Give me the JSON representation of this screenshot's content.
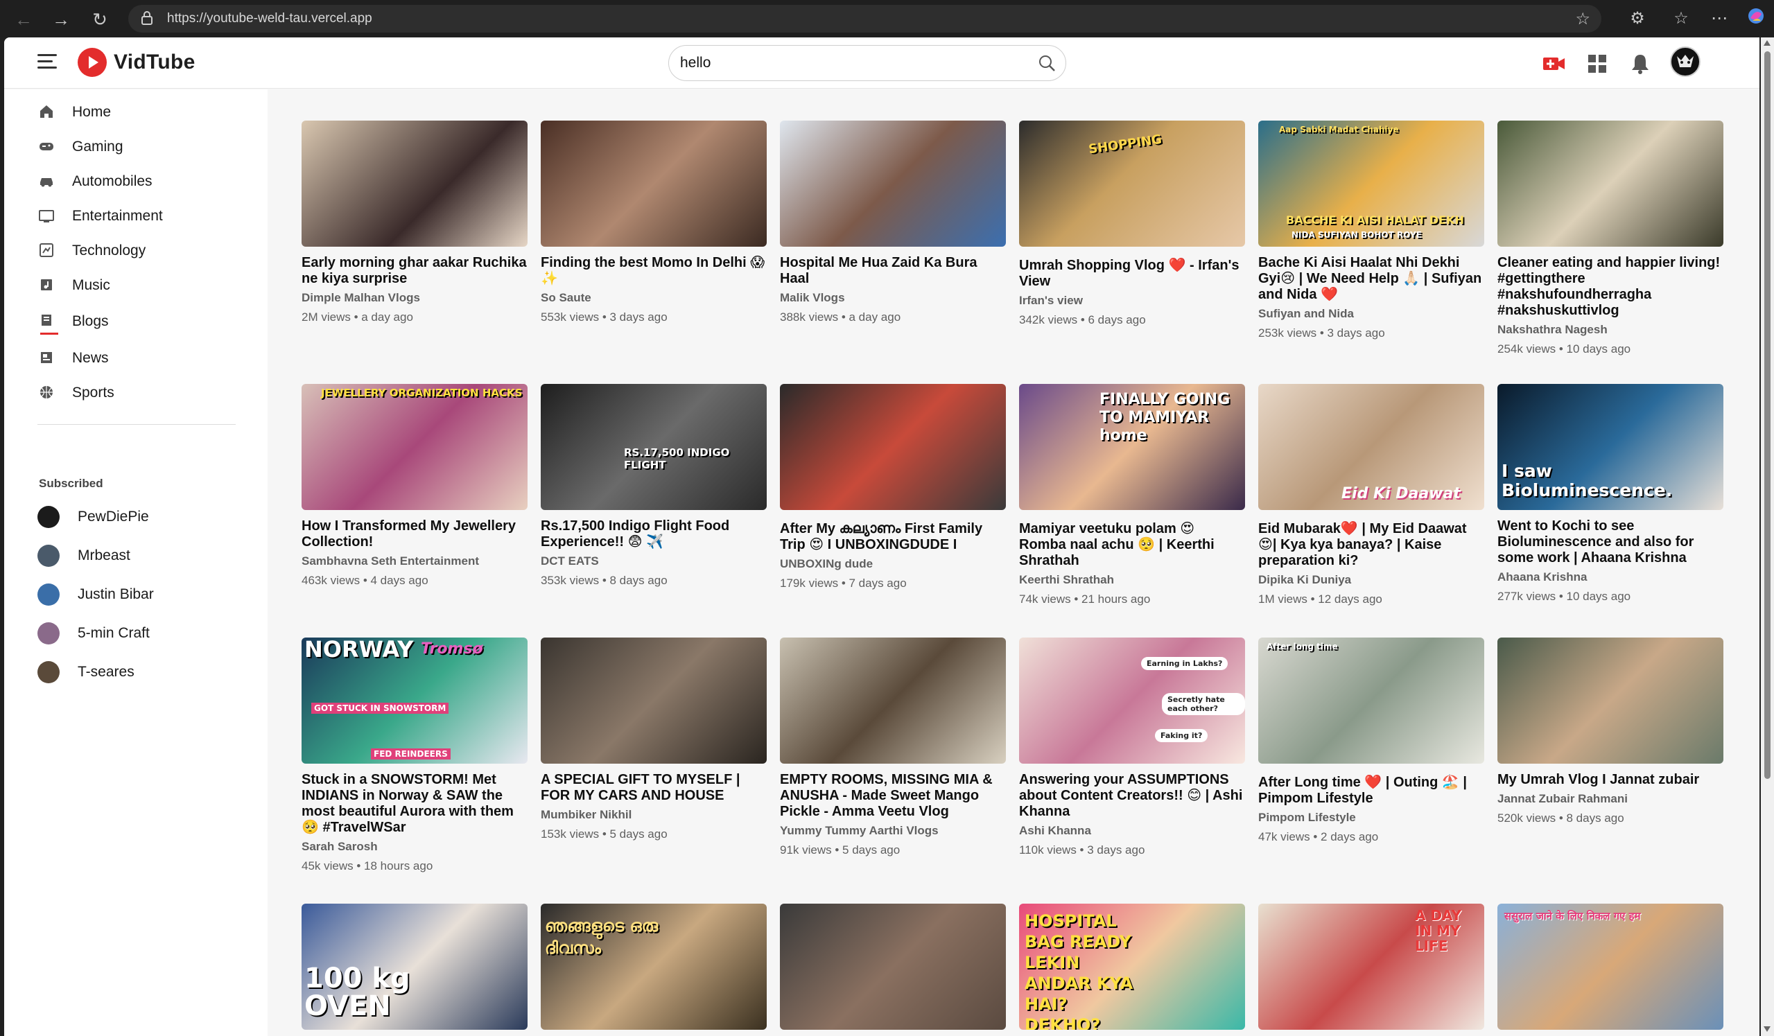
{
  "browser": {
    "url": "https://youtube-weld-tau.vercel.app"
  },
  "header": {
    "logo_text": "VidTube",
    "search_value": "hello"
  },
  "sidebar": {
    "items": [
      {
        "label": "Home",
        "icon": "home-icon"
      },
      {
        "label": "Gaming",
        "icon": "gamepad-icon"
      },
      {
        "label": "Automobiles",
        "icon": "car-icon"
      },
      {
        "label": "Entertainment",
        "icon": "tv-icon"
      },
      {
        "label": "Technology",
        "icon": "technology-icon"
      },
      {
        "label": "Music",
        "icon": "music-icon"
      },
      {
        "label": "Blogs",
        "icon": "blog-icon"
      },
      {
        "label": "News",
        "icon": "news-icon"
      },
      {
        "label": "Sports",
        "icon": "sports-icon"
      }
    ],
    "subscribed_heading": "Subscribed",
    "subscriptions": [
      {
        "name": "PewDiePie",
        "color": "#1b1b1b"
      },
      {
        "name": "Mrbeast",
        "color": "#4a5a6a"
      },
      {
        "name": "Justin Bibar",
        "color": "#3a6ea8"
      },
      {
        "name": "5-min Craft",
        "color": "#8a6a8a"
      },
      {
        "name": "T-seares",
        "color": "#5a4a3a"
      }
    ],
    "active_color": "#e32c2c"
  },
  "videos": [
    {
      "title": "Early morning ghar aakar Ruchika ne kiya surprise",
      "channel": "Dimple Malhan Vlogs",
      "meta": "2M views • a day ago",
      "thumb_bg": "linear-gradient(135deg,#d9c7b0,#3a2a2a 60%,#e6d6c6)"
    },
    {
      "title": "Finding the best Momo In Delhi 😱✨",
      "channel": "So Saute",
      "meta": "553k views • 3 days ago",
      "thumb_bg": "linear-gradient(135deg,#4a2f25,#b08870 50%,#3b2a22)"
    },
    {
      "title": "Hospital Me Hua Zaid Ka Bura Haal",
      "channel": "Malik Vlogs",
      "meta": "388k views • a day ago",
      "thumb_bg": "linear-gradient(135deg,#dfe6ee,#7d5a4a 50%,#3b6fb0)"
    },
    {
      "title": "Umrah Shopping Vlog ❤️ - Irfan's View",
      "channel": "Irfan's view",
      "meta": "342k views • 6 days ago",
      "thumb_bg": "linear-gradient(135deg,#2c2c2c,#c8a060 45%,#e6c8a8)"
    },
    {
      "title": "Bache Ki Aisi Haalat Nhi Dekhi Gyi😢 | We Need Help 🙏🏻 | Sufiyan and Nida ❤️",
      "channel": "Sufiyan and Nida",
      "meta": "253k views • 3 days ago",
      "thumb_bg": "linear-gradient(135deg,#2a6e8a,#e8b04a 50%,#d8d8d8)"
    },
    {
      "title": "Cleaner eating and happier living! #gettingthere #nakshufoundherragha #nakshuskuttivlog",
      "channel": "Nakshathra Nagesh",
      "meta": "254k views • 10 days ago",
      "thumb_bg": "linear-gradient(135deg,#4a5a3a,#dcd0b8 50%,#3a3a2a)"
    },
    {
      "title": "How I Transformed My Jewellery Collection!",
      "channel": "Sambhavna Seth Entertainment",
      "meta": "463k views • 4 days ago",
      "thumb_bg": "linear-gradient(135deg,#d8c0b8,#a8487a 50%,#e8d0c0)"
    },
    {
      "title": "Rs.17,500 Indigo Flight Food Experience!! 😨 ✈️",
      "channel": "DCT EATS",
      "meta": "353k views • 8 days ago",
      "thumb_bg": "linear-gradient(135deg,#1e1e1e,#6a6a6a 50%,#2a2a2a)"
    },
    {
      "title": "After My കല്യാണം First Family Trip 😍 I UNBOXINGDUDE I",
      "channel": "UNBOXINg dude",
      "meta": "179k views • 7 days ago",
      "thumb_bg": "linear-gradient(135deg,#2a2a2a,#c84a3a 50%,#3a3a3a)"
    },
    {
      "title": "Mamiyar veetuku polam 😍 Romba naal achu 🥺 | Keerthi Shrathah",
      "channel": "Keerthi Shrathah",
      "meta": "74k views • 21 hours ago",
      "thumb_bg": "linear-gradient(135deg,#6a4a8a,#e8b890 50%,#3a2a4a)"
    },
    {
      "title": "Eid Mubarak❤️ | My Eid Daawat 😍| Kya kya banaya? | Kaise preparation ki?",
      "channel": "Dipika Ki Duniya",
      "meta": "1M views • 12 days ago",
      "thumb_bg": "linear-gradient(135deg,#e8d8c8,#b89878 50%,#f0e0d0)"
    },
    {
      "title": "Went to Kochi to see Bioluminescence and also for some work | Ahaana Krishna",
      "channel": "Ahaana Krishna",
      "meta": "277k views • 10 days ago",
      "thumb_bg": "linear-gradient(135deg,#0a1a2a,#2a6a9a 50%,#e8e0d8)"
    },
    {
      "title": "Stuck in a SNOWSTORM! Met INDIANS in Norway & SAW the most beautiful Aurora with them 🥺 #TravelWSar",
      "channel": "Sarah Sarosh",
      "meta": "45k views • 18 hours ago",
      "thumb_bg": "linear-gradient(135deg,#1a3a5a,#3aa88a 50%,#e8e8f0)"
    },
    {
      "title": "A SPECIAL GIFT TO MYSELF | FOR MY CARS AND HOUSE",
      "channel": "Mumbiker Nikhil",
      "meta": "153k views • 5 days ago",
      "thumb_bg": "linear-gradient(135deg,#3a3530,#8a7868 50%,#2a2520)"
    },
    {
      "title": "EMPTY ROOMS, MISSING MIA & ANUSHA - Made Sweet Mango Pickle - Amma Veetu Vlog",
      "channel": "Yummy Tummy Aarthi Vlogs",
      "meta": "91k views • 5 days ago",
      "thumb_bg": "linear-gradient(135deg,#c8c0b0,#5a4a3a 50%,#d8d0c0)"
    },
    {
      "title": "Answering your ASSUMPTIONS about Content Creators!! 😊 | Ashi Khanna",
      "channel": "Ashi Khanna",
      "meta": "110k views • 3 days ago",
      "thumb_bg": "linear-gradient(135deg,#f0e0d8,#c87898 50%,#f8e8e0)"
    },
    {
      "title": "After Long time ❤️ | Outing 🏖️ | Pimpom Lifestyle",
      "channel": "Pimpom Lifestyle",
      "meta": "47k views • 2 days ago",
      "thumb_bg": "linear-gradient(135deg,#d8d8d0,#8a9a8a 50%,#e8e8e0)"
    },
    {
      "title": "My Umrah Vlog I Jannat zubair",
      "channel": "Jannat Zubair Rahmani",
      "meta": "520k views • 8 days ago",
      "thumb_bg": "linear-gradient(135deg,#4a5a4a,#c8a888 50%,#6a7a6a)"
    },
    {
      "title": "",
      "channel": "",
      "meta": "",
      "thumb_bg": "linear-gradient(135deg,#3a5a9a,#e8e0d8 50%,#2a3a5a)"
    },
    {
      "title": "",
      "channel": "",
      "meta": "",
      "thumb_bg": "linear-gradient(135deg,#2a2a2a,#c8a880 50%,#3a3020)"
    },
    {
      "title": "",
      "channel": "",
      "meta": "",
      "thumb_bg": "linear-gradient(135deg,#3a3a3a,#8a7060 50%,#5a4a40)"
    },
    {
      "title": "",
      "channel": "",
      "meta": "",
      "thumb_bg": "linear-gradient(135deg,#e84a7a,#f0c8a0 50%,#3ab8a8)"
    },
    {
      "title": "",
      "channel": "",
      "meta": "",
      "thumb_bg": "linear-gradient(135deg,#e8e0d0,#c84a4a 50%,#f0e8e0)"
    },
    {
      "title": "",
      "channel": "",
      "meta": "",
      "thumb_bg": "linear-gradient(135deg,#8ab0d8,#d8a878 50%,#6a90b8)"
    }
  ],
  "thumb_texts": {
    "jewellery": "JEWELLERY ORGANIZATION HACKS",
    "indigo": "RS.17,500 INDIGO FLIGHT",
    "mamiyar": "FINALLY GOING TO MAMIYAR home",
    "eid": "Eid Ki Daawat",
    "biolum": "I saw Bioluminescence.",
    "norway": "NORWAY",
    "tromso": "Tromsø",
    "snowstorm": "GOT STUCK IN SNOWSTORM",
    "reindeers": "FED REINDEERS",
    "earning": "Earning in Lakhs?",
    "hate": "Secretly hate each other?",
    "faking": "Faking it?",
    "after_long": "After long time",
    "bacche": "BACCHE KI AISI HALAT DEKH",
    "nida": "NIDA SUFIYAN BOHOT ROYE",
    "aap_sabki": "Aap Sabki Madat Chahiye",
    "shopping": "SHOPPING",
    "oven": "100 kg OVEN",
    "malayalam": "ഞങ്ങളുടെ ഒരു ദിവസം",
    "hospital_bag": "HOSPITAL BAG READY LEKIN ANDAR KYA HAI? DEKHO?",
    "a_day": "A DAY IN MY LIFE",
    "hindi": "ससुराल जाने के लिए निकल गए हम"
  }
}
